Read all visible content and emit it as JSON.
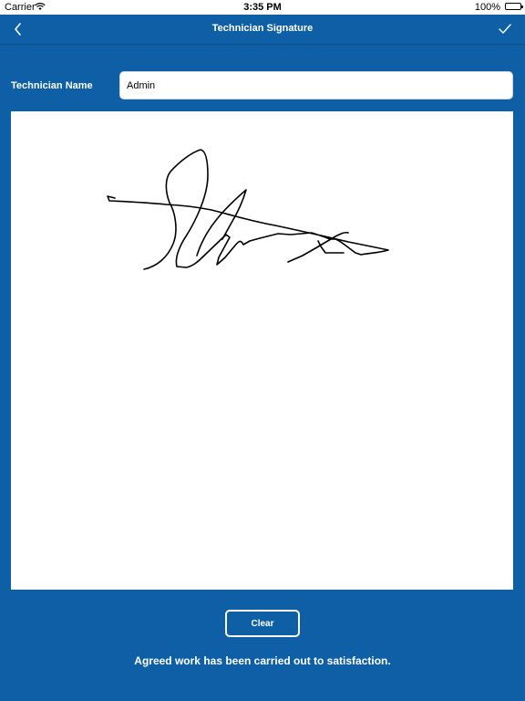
{
  "status_bar": {
    "carrier": "Carrier",
    "time": "3:35 PM",
    "battery_percent": "100%"
  },
  "nav_bar": {
    "title": "Technician Signature",
    "back_icon": "chevron-left-icon",
    "done_icon": "checkmark-icon"
  },
  "form": {
    "name_label": "Technician Name",
    "name_value": "Admin"
  },
  "signature": {
    "has_signature": true
  },
  "actions": {
    "clear_label": "Clear"
  },
  "footer": {
    "text": "Agreed work has been carried out to satisfaction."
  },
  "colors": {
    "background": "#0e5fa6",
    "pad": "#ffffff",
    "ink": "#000000"
  }
}
